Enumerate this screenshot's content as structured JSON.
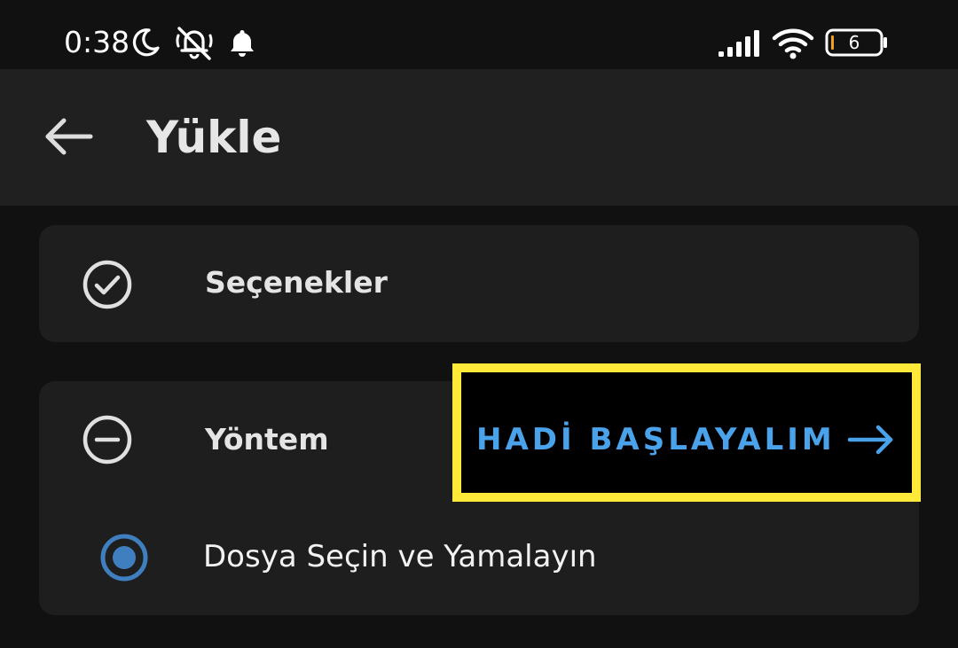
{
  "status_bar": {
    "time": "0:38",
    "battery_level": "6",
    "icons": [
      "moon-icon",
      "mute-icon",
      "bell-icon",
      "signal-icon",
      "wifi-icon",
      "battery-icon"
    ]
  },
  "app_bar": {
    "title": "Yükle",
    "back_icon": "arrow-left-icon"
  },
  "options_card": {
    "label": "Seçenekler",
    "icon": "check-circle-icon"
  },
  "method_card": {
    "label": "Yöntem",
    "icon": "minus-circle-icon",
    "radio_option": {
      "label": "Dosya Seçin ve Yamalayın",
      "selected": true
    }
  },
  "start_action": {
    "label": "HADİ BAŞLAYALIM",
    "icon": "arrow-right-icon"
  },
  "colors": {
    "background": "#111111",
    "app_bar": "#202020",
    "card": "#1e1e1e",
    "accent": "#4aa3ea",
    "highlight": "#ffea3a",
    "text_primary": "#e6e6e6"
  }
}
